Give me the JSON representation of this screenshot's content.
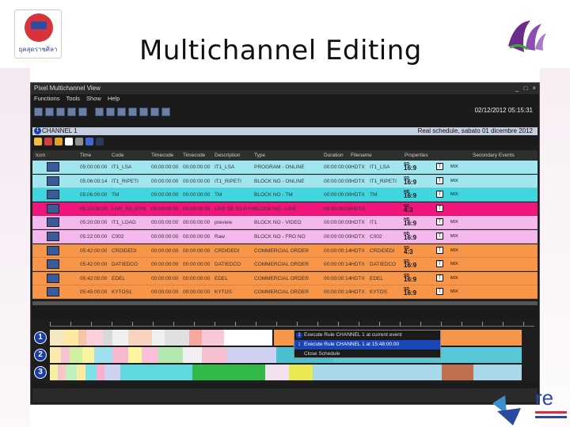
{
  "slide": {
    "title": "Multichannel Editing",
    "logo_caption": "ยุคสุดราชศิลา",
    "logo_right_name": "purple-bird-logo"
  },
  "window": {
    "title": "Pixel Multichannel View",
    "menu": [
      "Functions",
      "Tools",
      "Show",
      "Help"
    ],
    "clock": "02/12/2012 05:15:31",
    "channel_label": "CHANNEL 1",
    "channel_num": "1",
    "schedule": "Real schedule, sabato 01 dicembre 2012"
  },
  "table": {
    "columns": [
      "Icon",
      "Time",
      "Code",
      "Timecode",
      "Timecode",
      "Description",
      "Type",
      "Duration",
      "Filename",
      "Properties",
      "Secondary Events"
    ],
    "rows": [
      {
        "time": "05:00:00:00",
        "code": "IT1_LSA",
        "tc_in": "00:00:00:00",
        "tc_out": "00:00:00:00",
        "desc": "IT1_LSA",
        "type": "PROGRAM - ONLINE",
        "dur": "00:00:00:00",
        "fmt": "HDTX",
        "file": "IT1_LSA",
        "prop": "16:9",
        "sub": "SD",
        "color": "#9fe6ee",
        "mix": true
      },
      {
        "time": "05:06:00:14",
        "code": "IT1_RIPETI",
        "tc_in": "00:00:00:00",
        "tc_out": "00:00:00:00",
        "desc": "IT1_RIPETI",
        "type": "BLOCK NO - ONLINE",
        "dur": "00:00:00:00",
        "fmt": "HDTX",
        "file": "IT1_RIPETI",
        "prop": "16:9",
        "sub": "SD",
        "color": "#9fe6ee",
        "mix": true
      },
      {
        "time": "05:06:00:00",
        "code": "TM",
        "tc_in": "00:00:00:00",
        "tc_out": "00:00:00:00",
        "desc": "TM",
        "type": "BLOCK NO - TM",
        "dur": "00:00:00:00",
        "fmt": "HDTX",
        "file": "TM",
        "prop": "16:9",
        "sub": "HD",
        "color": "#40d6e0",
        "mix": true
      },
      {
        "time": "05:10:00:00",
        "code": "LIVE_5S_GYN",
        "tc_in": "00:00:00:00",
        "tc_out": "00:00:00:00",
        "desc": "LIVE SE 5S GYN",
        "type": "BLOCK NO - LIVE",
        "dur": "00:00:00:00",
        "fmt": "HDTX",
        "file": "",
        "prop": "4:3",
        "sub": "SD",
        "color": "#f0157a",
        "mix": false
      },
      {
        "time": "05:20:00:00",
        "code": "IT1_LOAD",
        "tc_in": "00:00:00:00",
        "tc_out": "00:00:00:00",
        "desc": "preview",
        "type": "BLOCK NO - VIDEO",
        "dur": "00:00:00:00",
        "fmt": "HDTX",
        "file": "IT1",
        "prop": "16:9",
        "sub": "HD",
        "color": "#f4b8ec",
        "mix": true
      },
      {
        "time": "05:22:00:00",
        "code": "C002",
        "tc_in": "00:00:00:00",
        "tc_out": "00:00:00:00",
        "desc": "Raw",
        "type": "BLOCK NO - FRO NO",
        "dur": "00:00:00:00",
        "fmt": "HDTX",
        "file": "C002",
        "prop": "16:9",
        "sub": "HD",
        "color": "#f4b8ec",
        "mix": true
      },
      {
        "time": "05:42:00:00",
        "code": "CRDIDEDI",
        "tc_in": "00:00:00:00",
        "tc_out": "00:00:00:00",
        "desc": "CRDIDEDI",
        "type": "COMMERCIAL ORDER",
        "dur": "00:00:00:14",
        "fmt": "HDTX",
        "file": "CRDIDEDI",
        "prop": "4:3",
        "sub": "SD",
        "color": "#f79548",
        "mix": true
      },
      {
        "time": "05:42:00:00",
        "code": "DATIEDCO",
        "tc_in": "00:00:00:00",
        "tc_out": "00:00:00:00",
        "desc": "DATIEDCO",
        "type": "COMMERCIAL ORDER",
        "dur": "00:00:00:14",
        "fmt": "HDTX",
        "file": "DATIEDCO",
        "prop": "16:9",
        "sub": "SD",
        "color": "#f79548",
        "mix": true
      },
      {
        "time": "05:42:00:00",
        "code": "EDEL",
        "tc_in": "00:00:00:00",
        "tc_out": "00:00:00:00",
        "desc": "EDEL",
        "type": "COMMERCIAL ORDER",
        "dur": "00:00:00:14",
        "fmt": "HDTX",
        "file": "EDEL",
        "prop": "16:9",
        "sub": "SD",
        "color": "#f79548",
        "mix": true
      },
      {
        "time": "05:45:00:00",
        "code": "KYTOS1",
        "tc_in": "00:00:00:00",
        "tc_out": "00:00:00:00",
        "desc": "KYTOS",
        "type": "COMMERCIAL ORDER",
        "dur": "00:00:00:14",
        "fmt": "HDTX",
        "file": "KYTOS",
        "prop": "16:9",
        "sub": "SD",
        "color": "#f79548",
        "mix": true
      }
    ],
    "mix_label": "MIX"
  },
  "timeline": {
    "lanes": [
      {
        "num": "1",
        "segments": [
          [
            "#f5e8c0",
            18
          ],
          [
            "#fde9a0",
            18
          ],
          [
            "#f7c4a6",
            10
          ],
          [
            "#f9d0d8",
            20
          ],
          [
            "#d8d8d8",
            12
          ],
          [
            "#f0f0f0",
            20
          ],
          [
            "#f7d3c0",
            30
          ],
          [
            "#f0f0f0",
            16
          ],
          [
            "#e0e0e0",
            30
          ],
          [
            "#f6a7a0",
            16
          ],
          [
            "#f7c9d8",
            28
          ],
          [
            "#ffffff",
            60
          ],
          [
            "#1a1a1a",
            2
          ],
          [
            "#f79548",
            110
          ],
          [
            "#f79548",
            200
          ]
        ]
      },
      {
        "num": "2",
        "segments": [
          [
            "#f9ebb0",
            14
          ],
          [
            "#f6c4d0",
            10
          ],
          [
            "#d0f0a0",
            16
          ],
          [
            "#fdf2a0",
            14
          ],
          [
            "#9ee0f0",
            22
          ],
          [
            "#f7b8d0",
            20
          ],
          [
            "#fff4a0",
            16
          ],
          [
            "#f9c0d8",
            20
          ],
          [
            "#b0e8b0",
            30
          ],
          [
            "#f0f0f0",
            24
          ],
          [
            "#f7c0d0",
            30
          ],
          [
            "#d0d0f0",
            60
          ],
          [
            "#48c0d0",
            70
          ],
          [
            "#58c8d8",
            230
          ]
        ]
      },
      {
        "num": "3",
        "segments": [
          [
            "#f0f0a0",
            10
          ],
          [
            "#f7c4c8",
            10
          ],
          [
            "#c0f0c0",
            14
          ],
          [
            "#fde9a0",
            10
          ],
          [
            "#80e0e8",
            14
          ],
          [
            "#f7b0d0",
            10
          ],
          [
            "#d0d0f0",
            20
          ],
          [
            "#60d8e0",
            90
          ],
          [
            "#30b848",
            90
          ],
          [
            "#f0e0f0",
            30
          ],
          [
            "#e8e850",
            30
          ],
          [
            "#a8d8e8",
            160
          ],
          [
            "#c07050",
            40
          ],
          [
            "#a8d8e8",
            60
          ]
        ]
      }
    ],
    "context_menu": [
      "Execute Rule CHANNEL 1 at current event",
      "Execute Rule CHANNEL 1 at 15:48:00:00",
      "Close Schedule"
    ],
    "context_selected": 1
  }
}
